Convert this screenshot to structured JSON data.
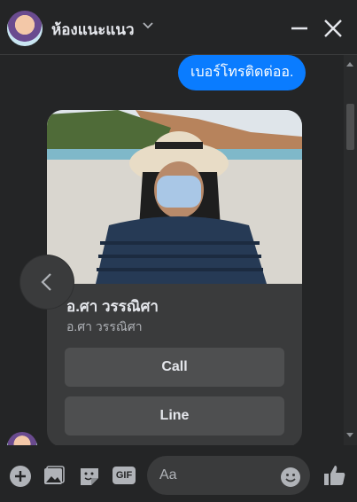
{
  "header": {
    "title": "ห้องแนะแนว"
  },
  "messages": {
    "outgoing_text": "เบอร์โทรติดต่ออ."
  },
  "card": {
    "name": "อ.ศา วรรณิศา",
    "subtitle": "อ.ศา วรรณิศา",
    "buttons": [
      {
        "label": "Call"
      },
      {
        "label": "Line"
      }
    ]
  },
  "composer": {
    "placeholder": "Aa",
    "gif_label": "GIF"
  },
  "colors": {
    "background": "#242526",
    "bubble": "#0a7cff",
    "card": "#3a3b3c",
    "button": "#4e4f50"
  }
}
